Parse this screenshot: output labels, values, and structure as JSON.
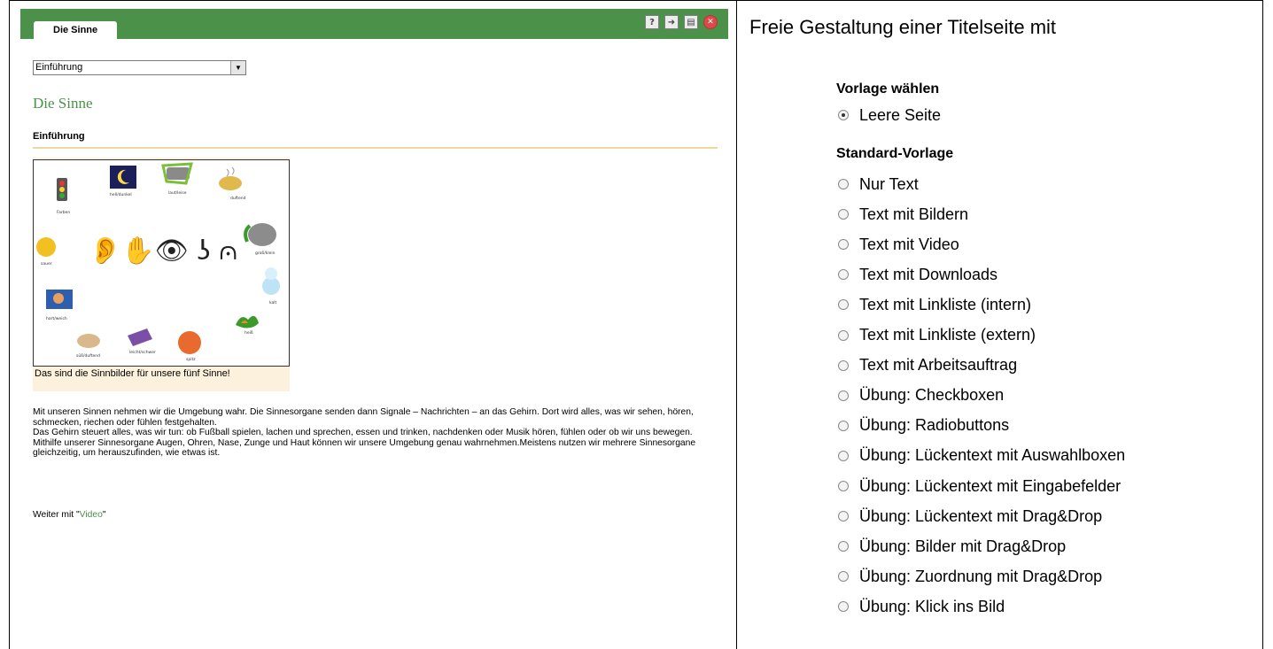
{
  "left": {
    "tab_label": "Die Sinne",
    "toolbar": [
      {
        "icon": "help-icon",
        "glyph": "?"
      },
      {
        "icon": "export-icon",
        "glyph": "➜"
      },
      {
        "icon": "print-icon",
        "glyph": "▤"
      },
      {
        "icon": "close-icon",
        "glyph": "✕"
      }
    ],
    "select_value": "Einführung",
    "page_title": "Die Sinne",
    "subheading": "Einführung",
    "figure": {
      "labels": [
        "Farben",
        "hell/dunkel",
        "laut/leise",
        "duftend",
        "groß/klein",
        "sauer",
        "kalt",
        "hart/weich",
        "heiß",
        "süß/duftend",
        "leicht/schwer",
        "spitz"
      ],
      "caption": "Das sind die Sinnbilder für unsere fünf Sinne!"
    },
    "paragraphs": [
      "Mit unseren Sinnen nehmen wir die Umgebung wahr. Die Sinnesorgane senden dann Signale – Nachrichten – an das Gehirn. Dort wird alles, was wir sehen, hören, schmecken, riechen oder fühlen festgehalten.",
      "Das Gehirn steuert alles, was wir tun: ob Fußball spielen, lachen und sprechen, essen und trinken, nachdenken oder Musik hören, fühlen oder ob wir uns bewegen.",
      "Mithilfe unserer Sinnesorgane Augen, Ohren, Nase, Zunge und Haut können wir unsere Umgebung genau wahrnehmen.Meistens nutzen wir mehrere Sinnesorgane gleichzeitig, um herauszufinden, wie etwas ist."
    ],
    "continue_prefix": "Weiter mit \"",
    "continue_link": "Video",
    "continue_suffix": "\""
  },
  "right": {
    "title": "Freie Gestaltung einer Titelseite mit",
    "group1_label": "Vorlage wählen",
    "group1_options": [
      "Leere Seite"
    ],
    "group1_selected": 0,
    "group2_label": "Standard-Vorlage",
    "group2_options": [
      "Nur Text",
      "Text mit Bildern",
      "Text mit Video",
      "Text mit Downloads",
      "Text mit Linkliste (intern)",
      "Text mit Linkliste (extern)",
      "Text mit Arbeitsauftrag",
      "Übung: Checkboxen",
      "Übung: Radiobuttons",
      "Übung: Lückentext mit Auswahlboxen",
      "Übung: Lückentext mit Eingabefelder",
      "Übung: Lückentext mit Drag&Drop",
      "Übung: Bilder mit Drag&Drop",
      "Übung: Zuordnung mit Drag&Drop",
      "Übung: Klick ins Bild"
    ]
  },
  "colors": {
    "accent_green": "#4b9149",
    "rule": "#eed8a0",
    "caption_bg": "#fbf1dc"
  }
}
